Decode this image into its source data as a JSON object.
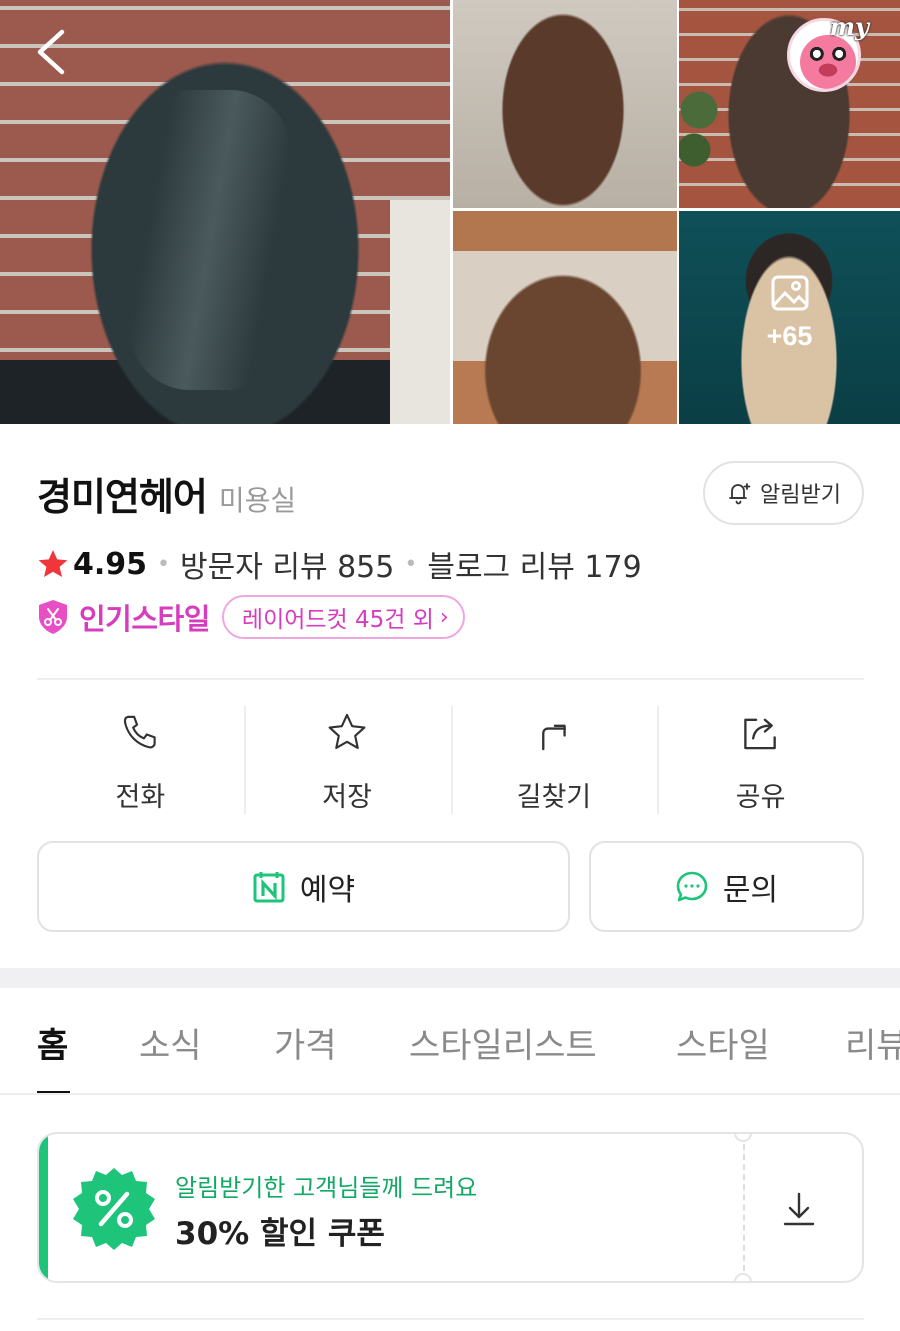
{
  "gallery": {
    "more_count": "+65",
    "my_badge": "my"
  },
  "store": {
    "name": "경미연헤어",
    "category": "미용실",
    "notify_label": "알림받기",
    "rating": "4.95",
    "visitor_reviews": "방문자 리뷰 855",
    "blog_reviews": "블로그 리뷰 179",
    "popular_label": "인기스타일",
    "popular_chip": "레이어드컷 45건 외"
  },
  "actions": [
    {
      "label": "전화",
      "icon": "phone-icon"
    },
    {
      "label": "저장",
      "icon": "star-icon"
    },
    {
      "label": "길찾기",
      "icon": "directions-icon"
    },
    {
      "label": "공유",
      "icon": "share-icon"
    }
  ],
  "buttons": {
    "book_label": "예약",
    "ask_label": "문의"
  },
  "tabs": [
    "홈",
    "소식",
    "가격",
    "스타일리스트",
    "스타일",
    "리뷰"
  ],
  "active_tab": "홈",
  "coupon": {
    "subtitle": "알림받기한 고객님들께 드려요",
    "title": "30% 할인 쿠폰",
    "badge_symbol": "%"
  },
  "colors": {
    "accent_green": "#1ec47a",
    "popular_pink": "#d63cbd",
    "rating_star": "#f0353b"
  }
}
